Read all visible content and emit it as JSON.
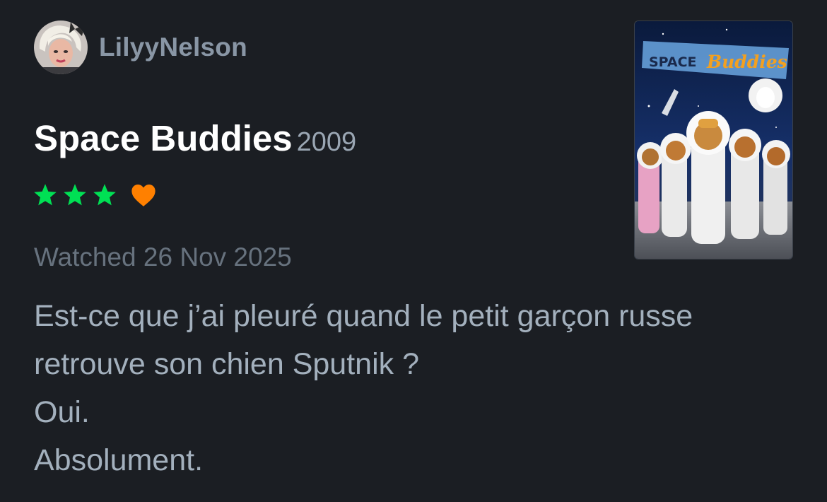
{
  "reviewer": {
    "username": "LilyyNelson",
    "avatar_icon": "user-avatar"
  },
  "film": {
    "title": "Space Buddies",
    "year": "2009",
    "poster_title_text": "SPACE Buddies"
  },
  "rating": {
    "stars": 3,
    "max_stars": 5,
    "star_color": "#00e054",
    "liked": true,
    "like_color": "#ff8000"
  },
  "watched_text": "Watched 26 Nov 2025",
  "review_lines": [
    "Est-ce que j’ai pleuré quand le petit garçon russe",
    "retrouve son chien Sputnik ?",
    "Oui.",
    "Absolument."
  ],
  "colors": {
    "background": "#1b1e23",
    "title": "#ffffff",
    "muted": "#8996a5",
    "body_text": "#a3b0bd"
  }
}
